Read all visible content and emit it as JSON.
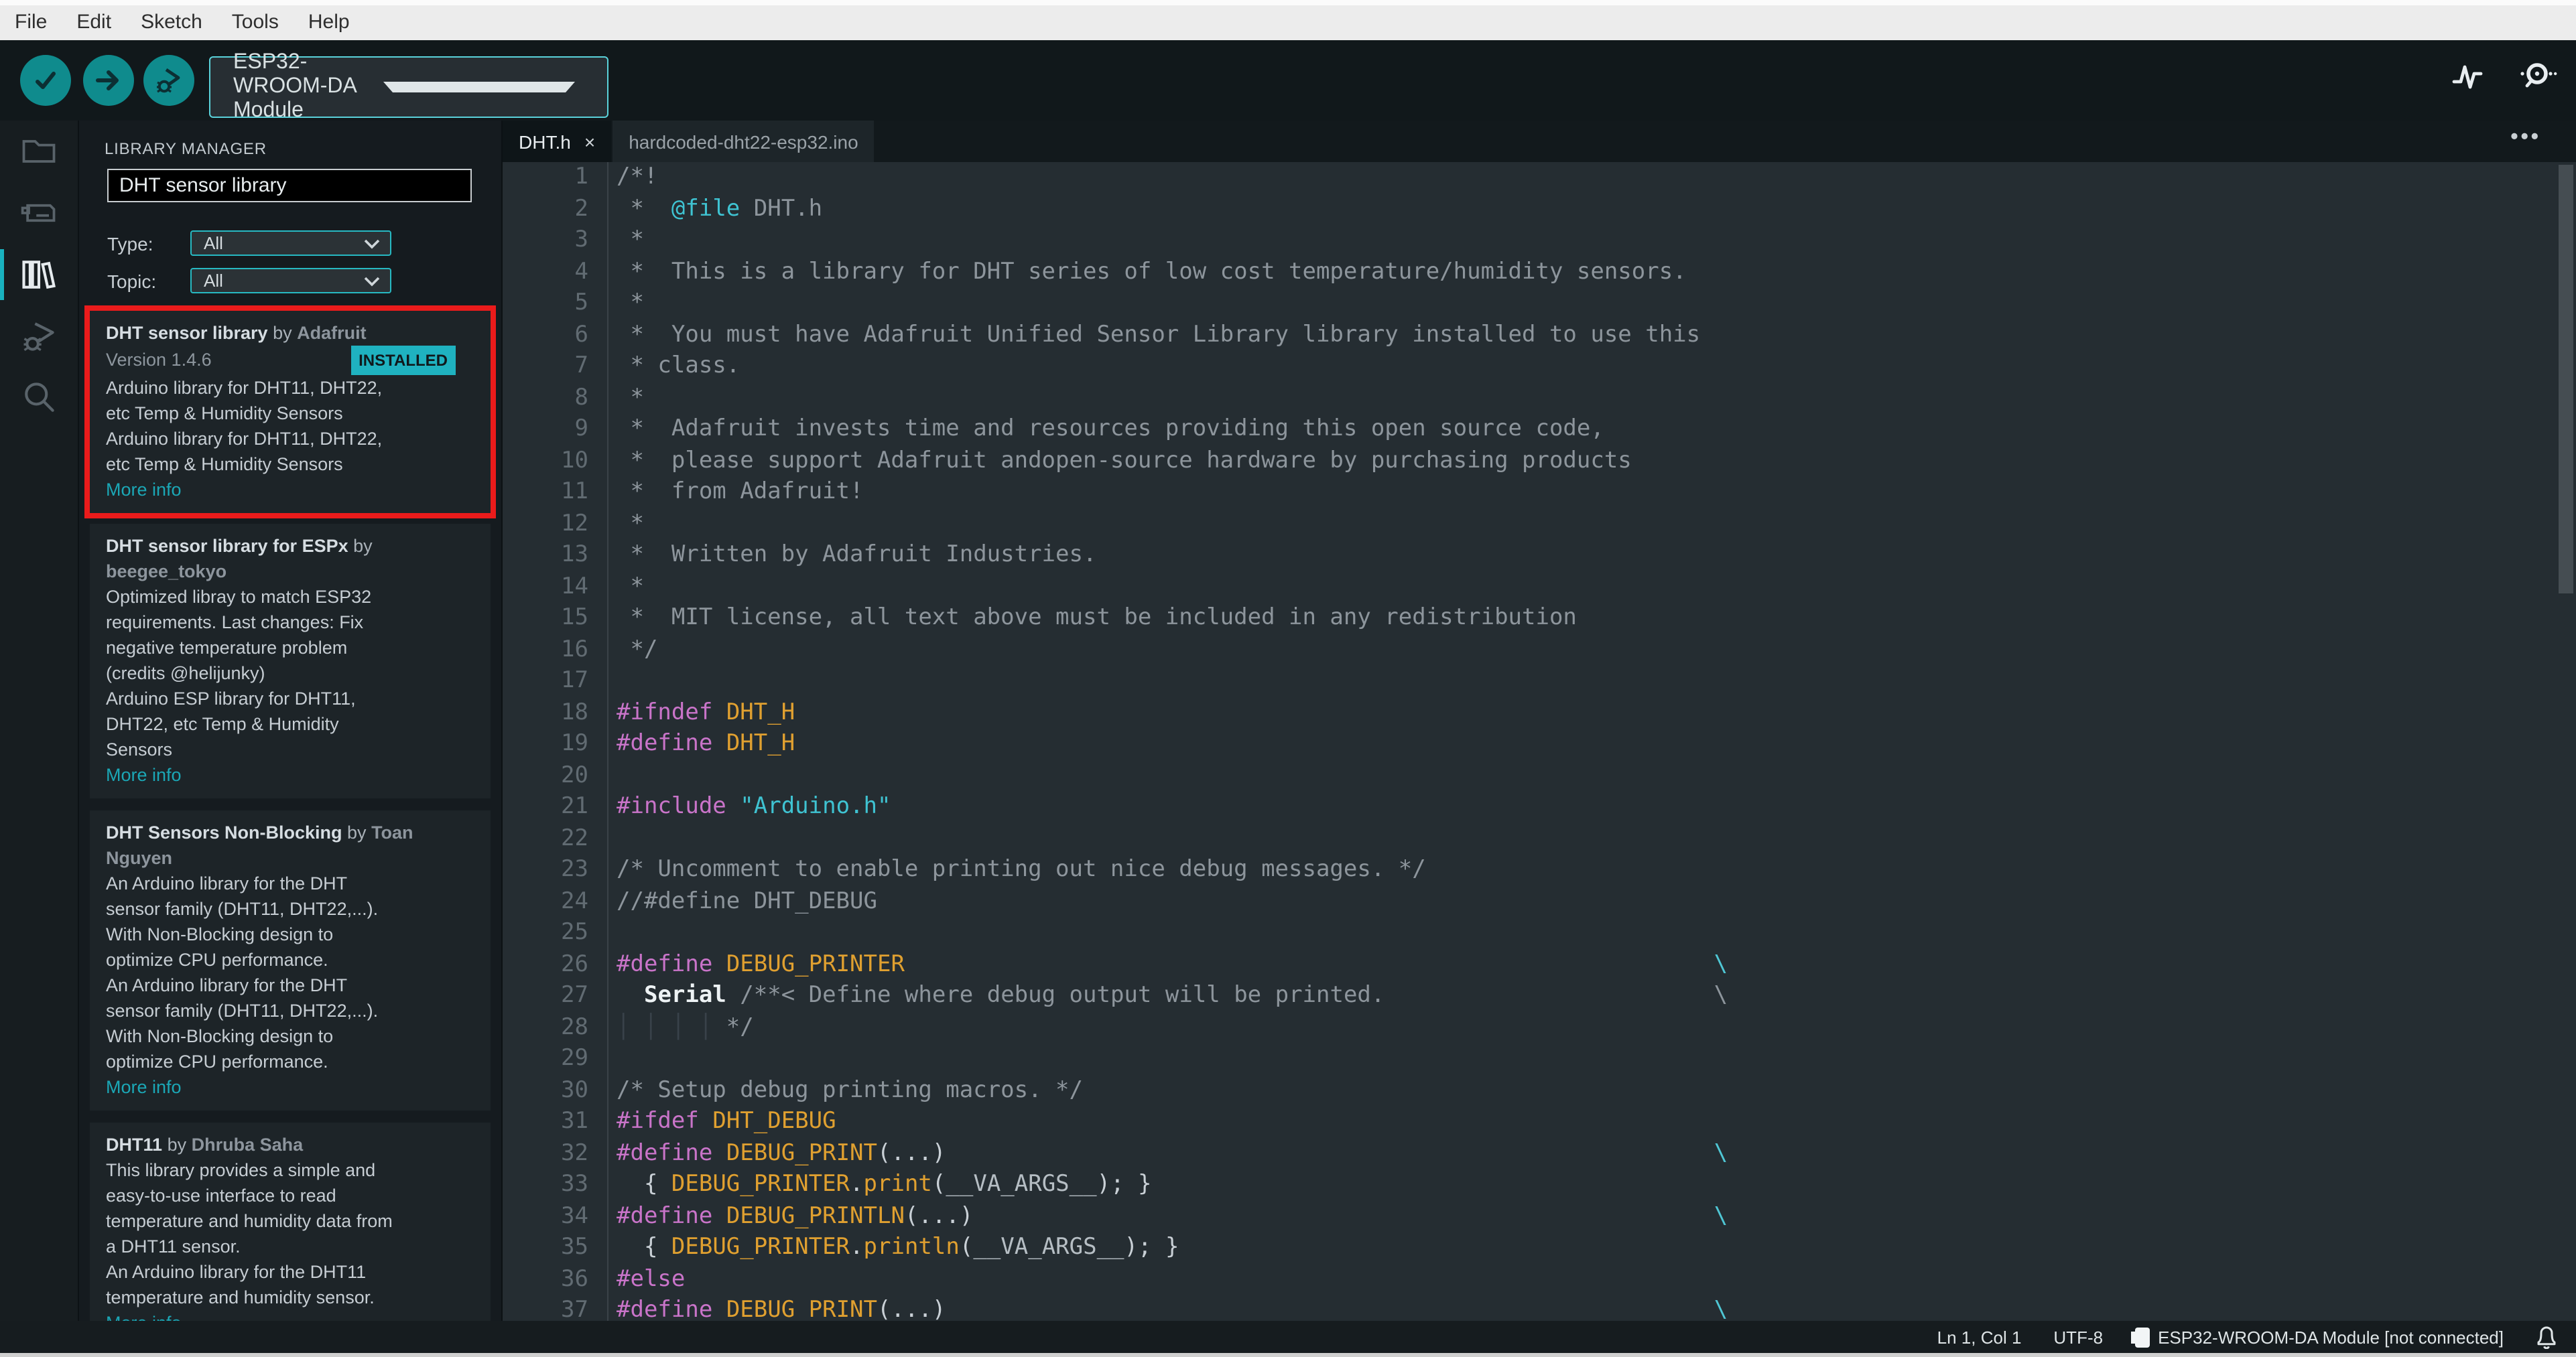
{
  "menubar": {
    "items": [
      "File",
      "Edit",
      "Sketch",
      "Tools",
      "Help"
    ]
  },
  "toolbar": {
    "board_selector": "ESP32-WROOM-DA Module",
    "buttons": [
      "verify-button",
      "upload-button",
      "debug-button"
    ],
    "right_icons": [
      "serial-plotter-icon",
      "serial-monitor-icon"
    ],
    "accent_color": "#0f8b8d"
  },
  "sidebar": {
    "icons": [
      "sketchbook-folder",
      "boards-manager",
      "library-manager",
      "debugger",
      "search"
    ],
    "active": "library-manager",
    "active_indicator_color": "#19b2bf"
  },
  "panel": {
    "title": "LIBRARY MANAGER",
    "search_value": "DHT sensor library",
    "filters": [
      {
        "label": "Type:",
        "value": "All"
      },
      {
        "label": "Topic:",
        "value": "All"
      }
    ],
    "annotation_color": "#ea1b1b",
    "badge_color": "#1fb2c0",
    "link_color": "#1ba7b6",
    "cards": [
      {
        "name": "DHT sensor library",
        "by": " by ",
        "author": "Adafruit",
        "version": "Version 1.4.6",
        "badge": "INSTALLED",
        "annotated": true,
        "desc": "Arduino library for DHT11, DHT22,\netc Temp & Humidity Sensors\nArduino library for DHT11, DHT22,\netc Temp & Humidity Sensors",
        "link": "More info"
      },
      {
        "name": "DHT sensor library for ESPx",
        "by": " by ",
        "author": "beegee_tokyo",
        "desc": "Optimized libray to match ESP32\nrequirements. Last changes: Fix\nnegative temperature problem\n(credits @helijunky)\nArduino ESP library for DHT11,\nDHT22, etc Temp & Humidity\nSensors",
        "link": "More info"
      },
      {
        "name": "DHT Sensors Non-Blocking",
        "by": " by ",
        "author": "Toan Nguyen",
        "desc": "An Arduino library for the DHT\nsensor family (DHT11, DHT22,...).\nWith Non-Blocking design to\noptimize CPU performance.\nAn Arduino library for the DHT\nsensor family (DHT11, DHT22,...).\nWith Non-Blocking design to\noptimize CPU performance.",
        "link": "More info"
      },
      {
        "name": "DHT11",
        "by": " by ",
        "author": "Dhruba Saha",
        "desc": "This library provides a simple and\neasy-to-use interface to read\ntemperature and humidity data from\na DHT11 sensor.\nAn Arduino library for the DHT11\ntemperature and humidity sensor.",
        "link": "More info"
      }
    ]
  },
  "editor": {
    "tabs": [
      {
        "label": "DHT.h",
        "active": true,
        "close": "×"
      },
      {
        "label": "hardcoded-dht22-esp32.ino",
        "active": false
      }
    ],
    "more_actions": "•••",
    "backslash_column": 80,
    "token_colors": {
      "com": "#8d959c",
      "pre": "#c974c9",
      "mac": "#e0a030",
      "str": "#3fc3d2",
      "pln": "#c9d0d6",
      "ser": "#edf2f4",
      "esc": "#4fc6d4",
      "fn": "#e0a030",
      "arg": "#b6bec4",
      "gde": "#39424a"
    },
    "lines": [
      {
        "n": 1,
        "seg": [
          [
            "/*!",
            "com"
          ]
        ]
      },
      {
        "n": 2,
        "seg": [
          [
            " *  ",
            "com"
          ],
          [
            "@file",
            "str"
          ],
          [
            " DHT.h",
            "com"
          ]
        ]
      },
      {
        "n": 3,
        "seg": [
          [
            " *",
            "com"
          ]
        ]
      },
      {
        "n": 4,
        "seg": [
          [
            " *  This is a library for DHT series of low cost temperature/humidity sensors.",
            "com"
          ]
        ]
      },
      {
        "n": 5,
        "seg": [
          [
            " *",
            "com"
          ]
        ]
      },
      {
        "n": 6,
        "seg": [
          [
            " *  You must have Adafruit Unified Sensor Library library installed to use this",
            "com"
          ]
        ]
      },
      {
        "n": 7,
        "seg": [
          [
            " * class.",
            "com"
          ]
        ]
      },
      {
        "n": 8,
        "seg": [
          [
            " *",
            "com"
          ]
        ]
      },
      {
        "n": 9,
        "seg": [
          [
            " *  Adafruit invests time and resources providing this open source code,",
            "com"
          ]
        ]
      },
      {
        "n": 10,
        "seg": [
          [
            " *  please support Adafruit andopen-source hardware by purchasing products",
            "com"
          ]
        ]
      },
      {
        "n": 11,
        "seg": [
          [
            " *  from Adafruit!",
            "com"
          ]
        ]
      },
      {
        "n": 12,
        "seg": [
          [
            " *",
            "com"
          ]
        ]
      },
      {
        "n": 13,
        "seg": [
          [
            " *  Written by Adafruit Industries.",
            "com"
          ]
        ]
      },
      {
        "n": 14,
        "seg": [
          [
            " *",
            "com"
          ]
        ]
      },
      {
        "n": 15,
        "seg": [
          [
            " *  MIT license, all text above must be included in any redistribution",
            "com"
          ]
        ]
      },
      {
        "n": 16,
        "seg": [
          [
            " */",
            "com"
          ]
        ]
      },
      {
        "n": 17,
        "seg": []
      },
      {
        "n": 18,
        "seg": [
          [
            "#ifndef",
            "pre"
          ],
          [
            " ",
            "pln"
          ],
          [
            "DHT_H",
            "mac"
          ]
        ]
      },
      {
        "n": 19,
        "seg": [
          [
            "#define",
            "pre"
          ],
          [
            " ",
            "pln"
          ],
          [
            "DHT_H",
            "mac"
          ]
        ]
      },
      {
        "n": 20,
        "seg": []
      },
      {
        "n": 21,
        "seg": [
          [
            "#include",
            "pre"
          ],
          [
            " ",
            "pln"
          ],
          [
            "\"Arduino.h\"",
            "str"
          ]
        ]
      },
      {
        "n": 22,
        "seg": []
      },
      {
        "n": 23,
        "seg": [
          [
            "/* Uncomment to enable printing out nice debug messages. */",
            "com"
          ]
        ]
      },
      {
        "n": 24,
        "seg": [
          [
            "//#define DHT_DEBUG",
            "com"
          ]
        ]
      },
      {
        "n": 25,
        "seg": []
      },
      {
        "n": 26,
        "seg": [
          [
            "#define",
            "pre"
          ],
          [
            " ",
            "pln"
          ],
          [
            "DEBUG_PRINTER",
            "mac"
          ]
        ],
        "bs": "esc"
      },
      {
        "n": 27,
        "seg": [
          [
            "  ",
            "pln"
          ],
          [
            "Serial",
            "ser"
          ],
          [
            " /**< Define where debug output will be printed.",
            "com"
          ]
        ],
        "bs": "com"
      },
      {
        "n": 28,
        "seg": [
          [
            "│ │ │ │ ",
            "gde"
          ],
          [
            "*/",
            "com"
          ]
        ]
      },
      {
        "n": 29,
        "seg": []
      },
      {
        "n": 30,
        "seg": [
          [
            "/* Setup debug printing macros. */",
            "com"
          ]
        ]
      },
      {
        "n": 31,
        "seg": [
          [
            "#ifdef",
            "pre"
          ],
          [
            " ",
            "pln"
          ],
          [
            "DHT_DEBUG",
            "mac"
          ]
        ]
      },
      {
        "n": 32,
        "seg": [
          [
            "#define",
            "pre"
          ],
          [
            " ",
            "pln"
          ],
          [
            "DEBUG_PRINT",
            "mac"
          ],
          [
            "(...)",
            "pln"
          ]
        ],
        "bs": "esc"
      },
      {
        "n": 33,
        "seg": [
          [
            "  { ",
            "pln"
          ],
          [
            "DEBUG_PRINTER",
            "mac"
          ],
          [
            ".",
            "pln"
          ],
          [
            "print",
            "fn"
          ],
          [
            "(",
            "pln"
          ],
          [
            "__VA_ARGS__",
            "arg"
          ],
          [
            "); }",
            "pln"
          ]
        ]
      },
      {
        "n": 34,
        "seg": [
          [
            "#define",
            "pre"
          ],
          [
            " ",
            "pln"
          ],
          [
            "DEBUG_PRINTLN",
            "mac"
          ],
          [
            "(...)",
            "pln"
          ]
        ],
        "bs": "esc"
      },
      {
        "n": 35,
        "seg": [
          [
            "  { ",
            "pln"
          ],
          [
            "DEBUG_PRINTER",
            "mac"
          ],
          [
            ".",
            "pln"
          ],
          [
            "println",
            "fn"
          ],
          [
            "(",
            "pln"
          ],
          [
            "__VA_ARGS__",
            "arg"
          ],
          [
            "); }",
            "pln"
          ]
        ]
      },
      {
        "n": 36,
        "seg": [
          [
            "#else",
            "pre"
          ]
        ]
      },
      {
        "n": 37,
        "seg": [
          [
            "#define",
            "pre"
          ],
          [
            " ",
            "pln"
          ],
          [
            "DEBUG_PRINT",
            "mac"
          ],
          [
            "(...)",
            "pln"
          ]
        ],
        "bs": "esc"
      }
    ]
  },
  "statusbar": {
    "cursor": "Ln 1, Col 1",
    "encoding": "UTF-8",
    "board": "ESP32-WROOM-DA Module [not connected]",
    "icons": [
      "chip-icon",
      "bell-icon"
    ]
  }
}
